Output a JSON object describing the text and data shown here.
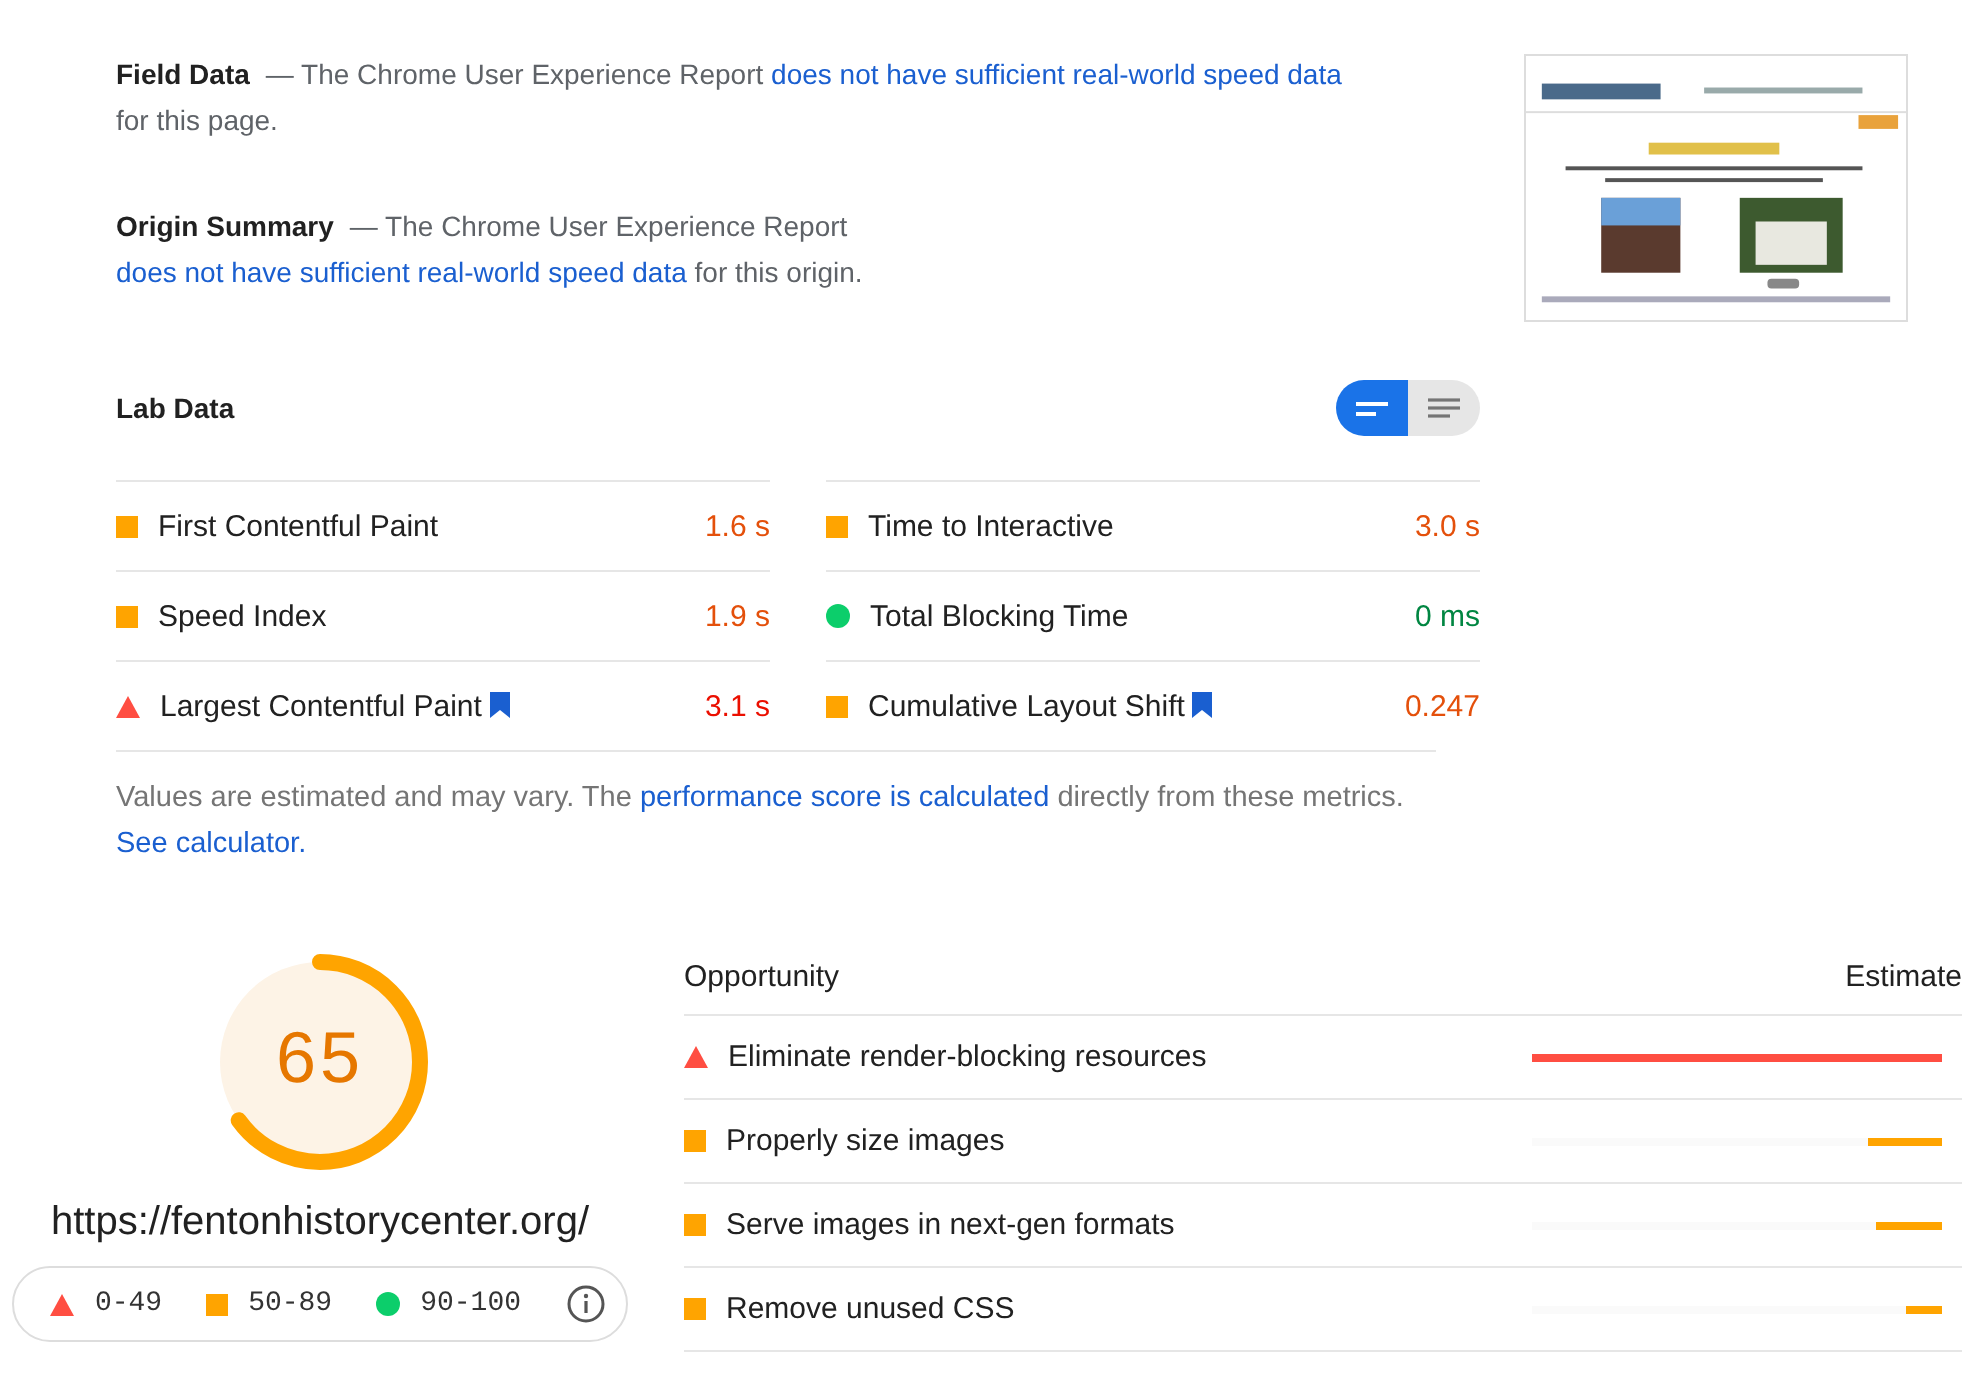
{
  "field_data": {
    "title": "Field Data",
    "before": "— The Chrome User Experience Report",
    "link": "does not have sufficient real-world speed data",
    "after": "for this page."
  },
  "origin_summary": {
    "title": "Origin Summary",
    "before": "— The Chrome User Experience Report",
    "link": "does not have sufficient real-world speed data",
    "after": "for this origin."
  },
  "lab_data": {
    "title": "Lab Data",
    "view_toggle": [
      {
        "kind": "opportunities",
        "selected": true
      },
      {
        "kind": "list",
        "selected": false
      }
    ],
    "metrics": [
      {
        "label": "First Contentful Paint",
        "value": "1.6 s",
        "kind": "average",
        "bookmark": false
      },
      {
        "label": "Time to Interactive",
        "value": "3.0 s",
        "kind": "average",
        "bookmark": false
      },
      {
        "label": "Speed Index",
        "value": "1.9 s",
        "kind": "average",
        "bookmark": false
      },
      {
        "label": "Total Blocking Time",
        "value": "0 ms",
        "kind": "pass",
        "bookmark": false
      },
      {
        "label": "Largest Contentful Paint",
        "value": "3.1 s",
        "kind": "fail",
        "bookmark": true
      },
      {
        "label": "Cumulative Layout Shift",
        "value": "0.247",
        "kind": "average",
        "bookmark": true
      }
    ],
    "note": {
      "before": "Values are estimated and may vary. The",
      "link": "performance score is calculated",
      "middle": "directly from these metrics.",
      "link2": "See calculator."
    }
  },
  "gauge": {
    "score": "65",
    "level": 0.65,
    "color": "#ffa400",
    "url": "https://fentonhistorycenter.org/"
  },
  "legend": [
    {
      "kind": "fail",
      "label": "0-49"
    },
    {
      "kind": "average",
      "label": "50-89"
    },
    {
      "kind": "pass",
      "label": "90-100"
    }
  ],
  "opportunities": {
    "columns": [
      "Opportunity",
      "Estimate"
    ],
    "rows": [
      {
        "label": "Eliminate render-blocking resources",
        "kind": "fail",
        "level": 1.0
      },
      {
        "label": "Properly size images",
        "kind": "average",
        "level": 0.18
      },
      {
        "label": "Serve images in next-gen formats",
        "kind": "average",
        "level": 0.16
      },
      {
        "label": "Remove unused CSS",
        "kind": "average",
        "level": 0.09
      }
    ]
  }
}
